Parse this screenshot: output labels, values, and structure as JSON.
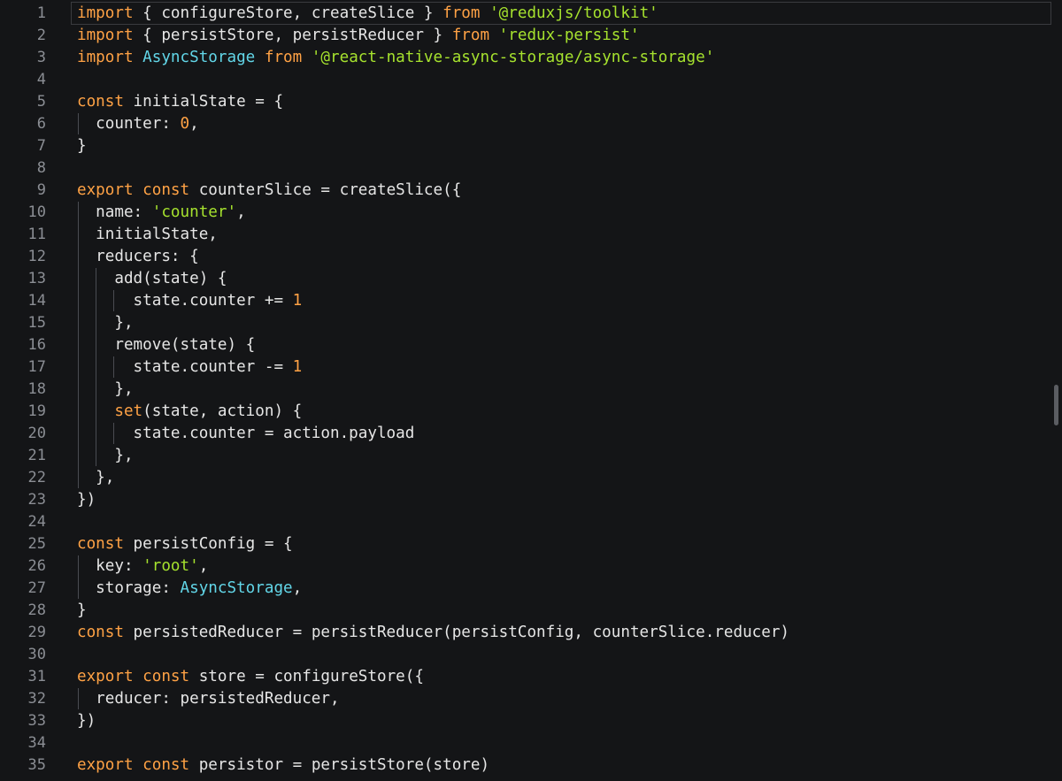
{
  "editor": {
    "colors": {
      "background": "#141517",
      "keyword": "#ffa245",
      "string": "#a6e22e",
      "number": "#ffa245",
      "type": "#62d6e8",
      "plain": "#e6e6e6",
      "line_number": "#8b8e94"
    },
    "lines": [
      {
        "n": "1",
        "tokens": [
          {
            "k": "keyword",
            "t": "import"
          },
          {
            "k": "plain",
            "t": " { configureStore, createSlice } "
          },
          {
            "k": "keyword",
            "t": "from"
          },
          {
            "k": "plain",
            "t": " "
          },
          {
            "k": "string",
            "t": "'@reduxjs/toolkit'"
          }
        ]
      },
      {
        "n": "2",
        "tokens": [
          {
            "k": "keyword",
            "t": "import"
          },
          {
            "k": "plain",
            "t": " { persistStore, persistReducer } "
          },
          {
            "k": "keyword",
            "t": "from"
          },
          {
            "k": "plain",
            "t": " "
          },
          {
            "k": "string",
            "t": "'redux-persist'"
          }
        ]
      },
      {
        "n": "3",
        "tokens": [
          {
            "k": "keyword",
            "t": "import"
          },
          {
            "k": "plain",
            "t": " "
          },
          {
            "k": "type",
            "t": "AsyncStorage"
          },
          {
            "k": "plain",
            "t": " "
          },
          {
            "k": "keyword",
            "t": "from"
          },
          {
            "k": "plain",
            "t": " "
          },
          {
            "k": "string",
            "t": "'@react-native-async-storage/async-storage'"
          }
        ]
      },
      {
        "n": "4",
        "tokens": []
      },
      {
        "n": "5",
        "tokens": [
          {
            "k": "keyword",
            "t": "const"
          },
          {
            "k": "plain",
            "t": " initialState = {"
          }
        ]
      },
      {
        "n": "6",
        "tokens": [
          {
            "k": "plain",
            "t": "  counter: "
          },
          {
            "k": "number",
            "t": "0"
          },
          {
            "k": "plain",
            "t": ","
          }
        ]
      },
      {
        "n": "7",
        "tokens": [
          {
            "k": "plain",
            "t": "}"
          }
        ]
      },
      {
        "n": "8",
        "tokens": []
      },
      {
        "n": "9",
        "tokens": [
          {
            "k": "keyword",
            "t": "export"
          },
          {
            "k": "plain",
            "t": " "
          },
          {
            "k": "keyword",
            "t": "const"
          },
          {
            "k": "plain",
            "t": " counterSlice = createSlice({"
          }
        ]
      },
      {
        "n": "10",
        "tokens": [
          {
            "k": "plain",
            "t": "  name: "
          },
          {
            "k": "string",
            "t": "'counter'"
          },
          {
            "k": "plain",
            "t": ","
          }
        ]
      },
      {
        "n": "11",
        "tokens": [
          {
            "k": "plain",
            "t": "  initialState,"
          }
        ]
      },
      {
        "n": "12",
        "tokens": [
          {
            "k": "plain",
            "t": "  reducers: {"
          }
        ]
      },
      {
        "n": "13",
        "tokens": [
          {
            "k": "plain",
            "t": "    add(state) {"
          }
        ]
      },
      {
        "n": "14",
        "tokens": [
          {
            "k": "plain",
            "t": "      state.counter += "
          },
          {
            "k": "number",
            "t": "1"
          }
        ]
      },
      {
        "n": "15",
        "tokens": [
          {
            "k": "plain",
            "t": "    },"
          }
        ]
      },
      {
        "n": "16",
        "tokens": [
          {
            "k": "plain",
            "t": "    remove(state) {"
          }
        ]
      },
      {
        "n": "17",
        "tokens": [
          {
            "k": "plain",
            "t": "      state.counter -= "
          },
          {
            "k": "number",
            "t": "1"
          }
        ]
      },
      {
        "n": "18",
        "tokens": [
          {
            "k": "plain",
            "t": "    },"
          }
        ]
      },
      {
        "n": "19",
        "tokens": [
          {
            "k": "plain",
            "t": "    "
          },
          {
            "k": "keyword",
            "t": "set"
          },
          {
            "k": "plain",
            "t": "(state, action) {"
          }
        ]
      },
      {
        "n": "20",
        "tokens": [
          {
            "k": "plain",
            "t": "      state.counter = action.payload"
          }
        ]
      },
      {
        "n": "21",
        "tokens": [
          {
            "k": "plain",
            "t": "    },"
          }
        ]
      },
      {
        "n": "22",
        "tokens": [
          {
            "k": "plain",
            "t": "  },"
          }
        ]
      },
      {
        "n": "23",
        "tokens": [
          {
            "k": "plain",
            "t": "})"
          }
        ]
      },
      {
        "n": "24",
        "tokens": []
      },
      {
        "n": "25",
        "tokens": [
          {
            "k": "keyword",
            "t": "const"
          },
          {
            "k": "plain",
            "t": " persistConfig = {"
          }
        ]
      },
      {
        "n": "26",
        "tokens": [
          {
            "k": "plain",
            "t": "  key: "
          },
          {
            "k": "string",
            "t": "'root'"
          },
          {
            "k": "plain",
            "t": ","
          }
        ]
      },
      {
        "n": "27",
        "tokens": [
          {
            "k": "plain",
            "t": "  storage: "
          },
          {
            "k": "type",
            "t": "AsyncStorage"
          },
          {
            "k": "plain",
            "t": ","
          }
        ]
      },
      {
        "n": "28",
        "tokens": [
          {
            "k": "plain",
            "t": "}"
          }
        ]
      },
      {
        "n": "29",
        "tokens": [
          {
            "k": "keyword",
            "t": "const"
          },
          {
            "k": "plain",
            "t": " persistedReducer = persistReducer(persistConfig, counterSlice.reducer)"
          }
        ]
      },
      {
        "n": "30",
        "tokens": []
      },
      {
        "n": "31",
        "tokens": [
          {
            "k": "keyword",
            "t": "export"
          },
          {
            "k": "plain",
            "t": " "
          },
          {
            "k": "keyword",
            "t": "const"
          },
          {
            "k": "plain",
            "t": " store = configureStore({"
          }
        ]
      },
      {
        "n": "32",
        "tokens": [
          {
            "k": "plain",
            "t": "  reducer: persistedReducer,"
          }
        ]
      },
      {
        "n": "33",
        "tokens": [
          {
            "k": "plain",
            "t": "})"
          }
        ]
      },
      {
        "n": "34",
        "tokens": []
      },
      {
        "n": "35",
        "tokens": [
          {
            "k": "keyword",
            "t": "export"
          },
          {
            "k": "plain",
            "t": " "
          },
          {
            "k": "keyword",
            "t": "const"
          },
          {
            "k": "plain",
            "t": " persistor = persistStore(store)"
          }
        ]
      }
    ]
  }
}
